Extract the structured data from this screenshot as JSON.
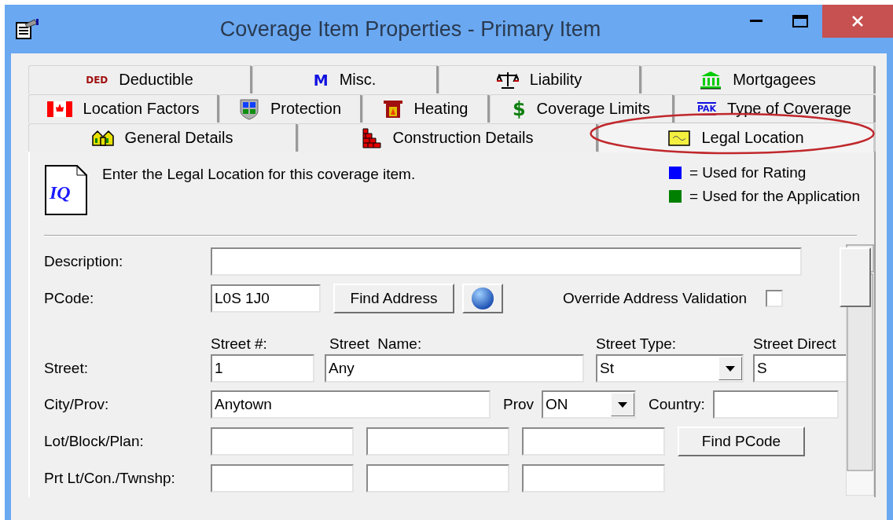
{
  "window": {
    "title": "Coverage Item Properties - Primary Item"
  },
  "tab_rows": [
    {
      "tabs": [
        {
          "label": "Deductible",
          "kind": "ded",
          "icon_text": "DED",
          "selected": false
        },
        {
          "label": "Misc.",
          "kind": "m",
          "icon_text": "M",
          "selected": false
        },
        {
          "label": "Liability",
          "kind": "scale",
          "selected": false
        },
        {
          "label": "Mortgagees",
          "kind": "bank",
          "selected": false
        }
      ]
    },
    {
      "tabs": [
        {
          "label": "Location Factors",
          "kind": "flag",
          "selected": false
        },
        {
          "label": "Protection",
          "kind": "shield",
          "selected": false
        },
        {
          "label": "Heating",
          "kind": "fireplace",
          "selected": false
        },
        {
          "label": "Coverage Limits",
          "kind": "dollar",
          "icon_text": "$",
          "selected": false
        },
        {
          "label": "Type of Coverage",
          "kind": "pak",
          "icon_text": "PAK",
          "selected": false
        }
      ]
    },
    {
      "tabs": [
        {
          "label": "General Details",
          "kind": "houses",
          "selected": false
        },
        {
          "label": "Construction Details",
          "kind": "bricks",
          "selected": false
        },
        {
          "label": "Legal Location",
          "kind": "map",
          "selected": true
        }
      ]
    }
  ],
  "header": {
    "logo_text": "IQ",
    "instruction": "Enter the Legal Location for this coverage item.",
    "legend": [
      {
        "color": "#0000ff",
        "label": "= Used for Rating"
      },
      {
        "color": "#008000",
        "label": "= Used for the Application"
      }
    ]
  },
  "form": {
    "description": {
      "label": "Description:"
    },
    "pcode": {
      "label": "PCode:",
      "value": "L0S 1J0",
      "find_button": "Find Address",
      "override": {
        "label": "Override Address Validation",
        "checked": false
      }
    },
    "street": {
      "label": "Street:",
      "fields": [
        {
          "heading": "Street #:",
          "value": "1",
          "kind": "text"
        },
        {
          "heading": "Street  Name:",
          "value": "Any",
          "kind": "text"
        },
        {
          "heading": "Street Type:",
          "value": "St",
          "kind": "select"
        },
        {
          "heading": "Street Direct",
          "value": "S",
          "kind": "text"
        }
      ]
    },
    "city": {
      "label": "City/Prov:",
      "value": "Anytown",
      "prov_label": "Prov",
      "prov_value": "ON",
      "country_label": "Country:"
    },
    "lot": {
      "label": "Lot/Block/Plan:",
      "button": "Find PCode"
    },
    "part_lot": {
      "label": "Prt Lt/Con./Twnshp:"
    }
  }
}
